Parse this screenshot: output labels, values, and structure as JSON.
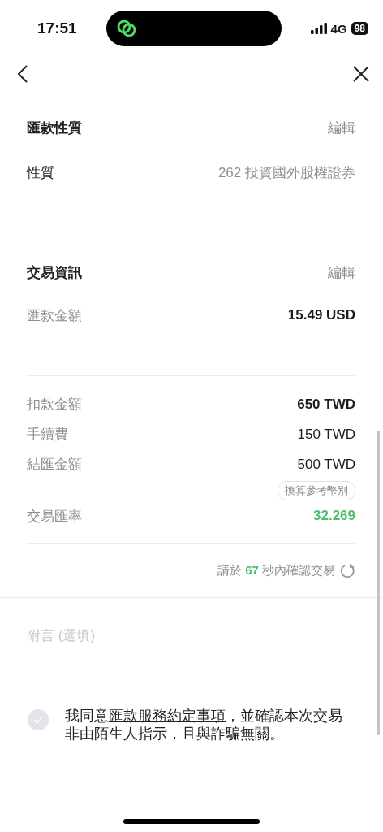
{
  "status_bar": {
    "time": "17:51",
    "network": "4G",
    "battery": "98"
  },
  "nature": {
    "title": "匯款性質",
    "action": "編輯",
    "rows": [
      {
        "label": "性質",
        "value": "262 投資國外股權證券"
      }
    ]
  },
  "transaction": {
    "title": "交易資訊",
    "action": "編輯",
    "amount": {
      "label": "匯款金額",
      "value": "15.49 USD"
    },
    "breakdown": [
      {
        "kind": "bold",
        "label": "扣款金額",
        "value": "650 TWD"
      },
      {
        "kind": "normal",
        "label": "手續費",
        "value": "150 TWD"
      },
      {
        "kind": "normal",
        "label": "結匯金額",
        "value": "500 TWD"
      },
      {
        "kind": "chip",
        "value": "換算參考幣別"
      },
      {
        "kind": "rate",
        "label": "交易匯率",
        "value": "32.269"
      }
    ],
    "countdown": {
      "prefix": "請於",
      "seconds": "67",
      "suffix": "秒內確認交易"
    }
  },
  "note": {
    "placeholder": "附言 (選填)"
  },
  "agreement": {
    "checked": false,
    "prefix": "我同意",
    "link": "匯款服務約定事項",
    "suffix": "，並確認本次交易非由陌生人指示，且與詐騙無關。"
  }
}
